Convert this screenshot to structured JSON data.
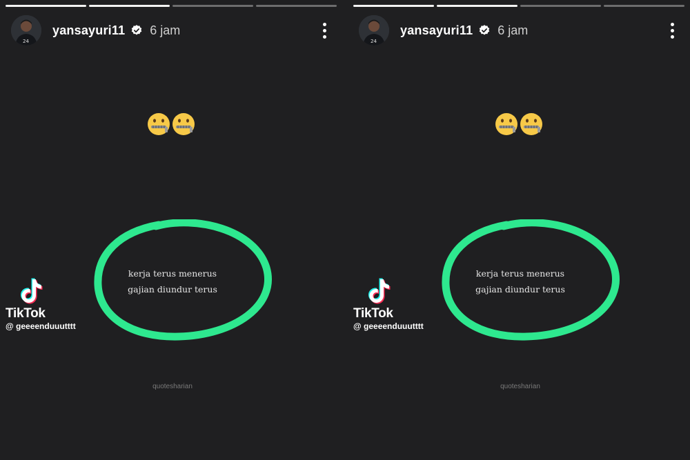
{
  "story": {
    "username": "yansayuri11",
    "time": "6 jam",
    "emojis": "🤐🤐",
    "quote_line1": "kerja terus menerus",
    "quote_line2": "gajian diundur terus",
    "tiktok_name": "TikTok",
    "tiktok_handle": "@ geeeenduuutttt",
    "watermark": "quotesharian",
    "progress_segments": 4,
    "progress_done": 2
  },
  "colors": {
    "background": "#1f1f21",
    "circle_stroke": "#2ee88f",
    "verified_badge": "#ffffff",
    "tiktok_cyan": "#25f4ee",
    "tiktok_red": "#fe2c55"
  },
  "icons": {
    "verified": "verified-badge-icon",
    "more": "more-options-icon",
    "tiktok": "tiktok-logo-icon"
  }
}
